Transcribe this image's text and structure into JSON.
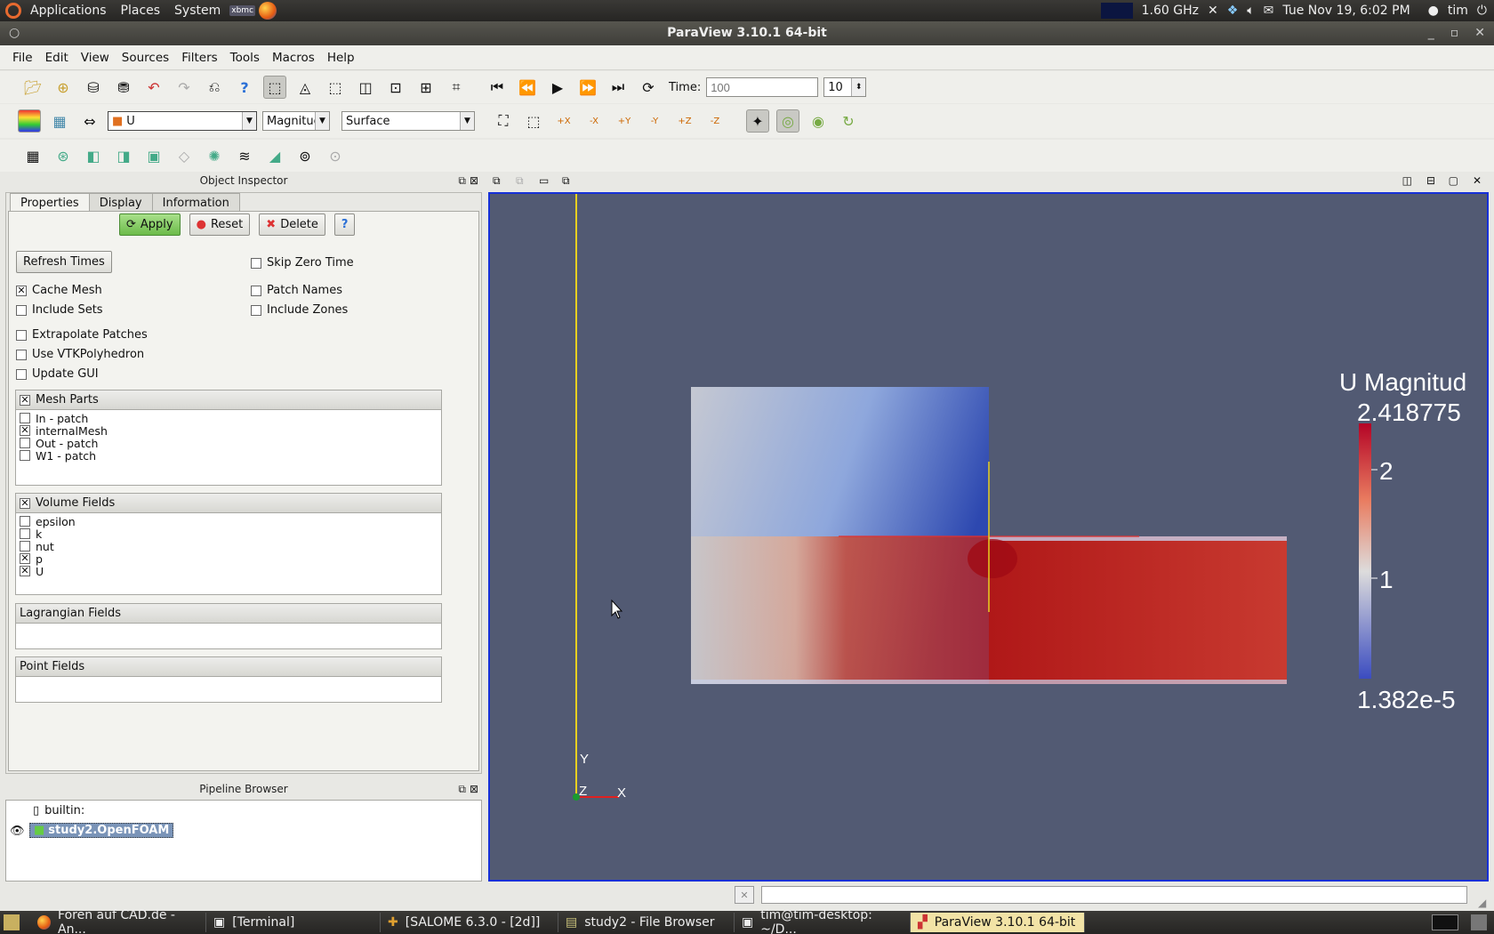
{
  "top_panel": {
    "menus": [
      "Applications",
      "Places",
      "System"
    ],
    "cpu_freq": "1.60 GHz",
    "datetime": "Tue Nov 19,  6:02 PM",
    "user": "tim"
  },
  "window": {
    "title": "ParaView 3.10.1 64-bit"
  },
  "menubar": [
    "File",
    "Edit",
    "View",
    "Sources",
    "Filters",
    "Tools",
    "Macros",
    "Help"
  ],
  "time_toolbar": {
    "label": "Time:",
    "time_placeholder": "100",
    "timestep": "10"
  },
  "color_toolbar": {
    "array": "U",
    "component": "Magnituc",
    "representation": "Surface",
    "camera_labels": [
      "+X",
      "-X",
      "+Y",
      "-Y",
      "+Z",
      "-Z"
    ]
  },
  "object_inspector": {
    "title": "Object Inspector",
    "tabs": [
      "Properties",
      "Display",
      "Information"
    ],
    "buttons": {
      "apply": "Apply",
      "reset": "Reset",
      "delete": "Delete",
      "help": "?"
    },
    "refresh_times": "Refresh Times",
    "options": [
      {
        "label": "Skip Zero Time",
        "checked": false
      },
      {
        "label": "Cache Mesh",
        "checked": true
      },
      {
        "label": "Patch Names",
        "checked": false
      },
      {
        "label": "Include Sets",
        "checked": false
      },
      {
        "label": "Include Zones",
        "checked": false
      },
      {
        "label": "Extrapolate Patches",
        "checked": false
      },
      {
        "label": "Use VTKPolyhedron",
        "checked": false
      },
      {
        "label": "Update GUI",
        "checked": false
      }
    ],
    "mesh_parts": {
      "title": "Mesh Parts",
      "items": [
        {
          "label": "In - patch",
          "checked": false
        },
        {
          "label": "internalMesh",
          "checked": true
        },
        {
          "label": "Out - patch",
          "checked": false
        },
        {
          "label": "W1 - patch",
          "checked": false
        }
      ]
    },
    "volume_fields": {
      "title": "Volume Fields",
      "items": [
        {
          "label": "epsilon",
          "checked": false
        },
        {
          "label": "k",
          "checked": false
        },
        {
          "label": "nut",
          "checked": false
        },
        {
          "label": "p",
          "checked": true
        },
        {
          "label": "U",
          "checked": true
        }
      ]
    },
    "lagrangian_fields": {
      "title": "Lagrangian Fields"
    },
    "point_fields": {
      "title": "Point Fields"
    }
  },
  "pipeline_browser": {
    "title": "Pipeline Browser",
    "items": [
      {
        "label": "builtin:"
      },
      {
        "label": "study2.OpenFOAM",
        "selected": true
      }
    ]
  },
  "render_view": {
    "background": "#525a73",
    "legend": {
      "title": "U Magnitud",
      "max": "2.418775",
      "min": "1.382e-5",
      "ticks": [
        "2",
        "1"
      ]
    },
    "axes": {
      "x": "X",
      "y": "Y",
      "z": "Z"
    }
  },
  "taskbar": {
    "items": [
      {
        "label": "Foren auf CAD.de - An...",
        "icon": "firefox-icon"
      },
      {
        "label": "[Terminal]",
        "icon": "terminal-icon"
      },
      {
        "label": "[SALOME 6.3.0 - [2d]]",
        "icon": "salome-icon"
      },
      {
        "label": "study2 - File Browser",
        "icon": "folder-icon"
      },
      {
        "label": "tim@tim-desktop: ~/D...",
        "icon": "terminal-icon"
      },
      {
        "label": "ParaView 3.10.1 64-bit",
        "icon": "paraview-icon",
        "active": true
      }
    ]
  }
}
